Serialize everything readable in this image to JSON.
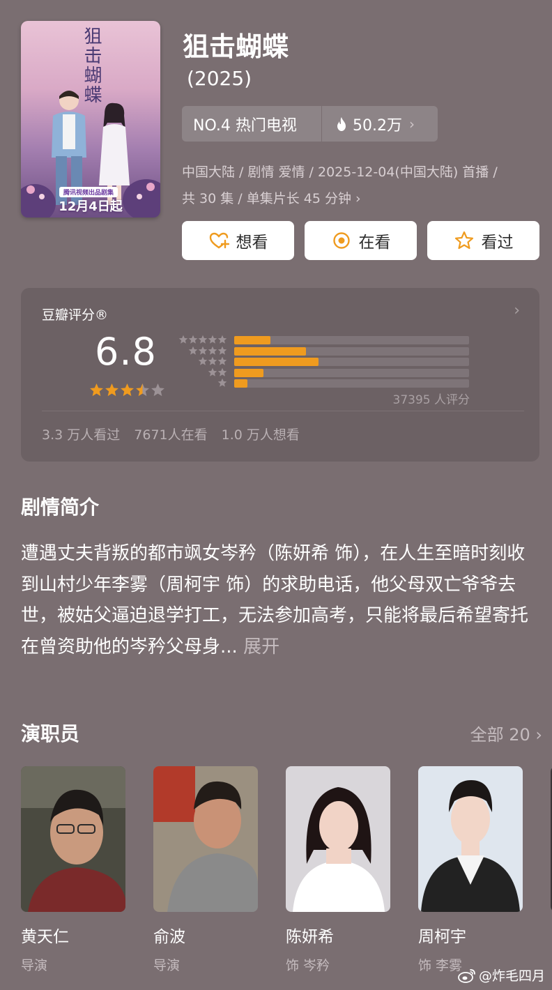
{
  "poster": {
    "title": "狙击蝴蝶",
    "badge": "腾讯视频出品剧集",
    "date": "12月4日起"
  },
  "header": {
    "title": "狙击蝴蝶",
    "year": "(2025)",
    "rank": "NO.4 热门电视",
    "heat": "50.2万",
    "meta_line1": "中国大陆 / 剧情 爱情 / 2025-12-04(中国大陆) 首播 /",
    "meta_line2": "共 30 集 / 单集片长 45 分钟"
  },
  "actions": {
    "want": "想看",
    "watching": "在看",
    "watched": "看过"
  },
  "rating": {
    "label": "豆瓣评分®",
    "score": "6.8",
    "score_stars": 3.5,
    "distribution": [
      {
        "stars": 5,
        "fraction": 0.155
      },
      {
        "stars": 4,
        "fraction": 0.305
      },
      {
        "stars": 3,
        "fraction": 0.36
      },
      {
        "stars": 2,
        "fraction": 0.125
      },
      {
        "stars": 1,
        "fraction": 0.055
      }
    ],
    "count": "37395 人评分",
    "stats": [
      "3.3 万人看过",
      "7671人在看",
      "1.0 万人想看"
    ]
  },
  "synopsis": {
    "title": "剧情简介",
    "text": "遭遇丈夫背叛的都市飒女岑矜（陈妍希 饰），在人生至暗时刻收到山村少年李雾（周柯宇 饰）的求助电话，他父母双亡爷爷去世，被姑父逼迫退学打工，无法参加高考，只能将最后希望寄托在曾资助他的岑矜父母身... ",
    "expand": "展开"
  },
  "cast": {
    "title": "演职员",
    "all": "全部 20",
    "members": [
      {
        "name": "黄天仁",
        "role": "导演"
      },
      {
        "name": "俞波",
        "role": "导演"
      },
      {
        "name": "陈妍希",
        "role": "饰 岑矜"
      },
      {
        "name": "周柯宇",
        "role": "饰 李雾"
      }
    ]
  },
  "watermark": "@炸毛四月",
  "colors": {
    "background": "#7a6e71",
    "card": "#6c6164",
    "accent_orange": "#ef9b1f"
  }
}
